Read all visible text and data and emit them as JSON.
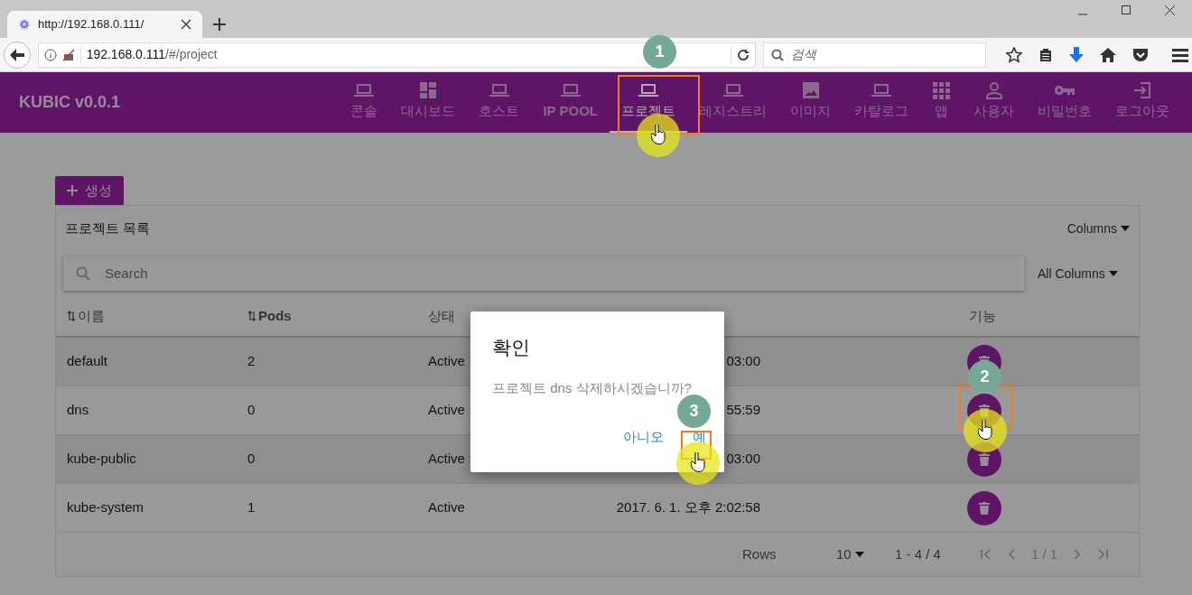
{
  "browser": {
    "tab_title": "http://192.168.0.111/",
    "url_host": "192.168.0.111",
    "url_path": "/#/project",
    "search_placeholder": "검색"
  },
  "app": {
    "title": "KUBIC v0.0.1"
  },
  "nav": [
    {
      "label": "콘솔",
      "kind": "laptop",
      "selected": false
    },
    {
      "label": "대시보드",
      "kind": "dashboard",
      "selected": false
    },
    {
      "label": "호스트",
      "kind": "laptop",
      "selected": false
    },
    {
      "label": "IP POOL",
      "kind": "laptop",
      "selected": false
    },
    {
      "label": "프로젝트",
      "kind": "laptop",
      "selected": true
    },
    {
      "label": "레지스트리",
      "kind": "laptop",
      "selected": false
    },
    {
      "label": "이미지",
      "kind": "image",
      "selected": false
    },
    {
      "label": "카탈로그",
      "kind": "laptop",
      "selected": false
    },
    {
      "label": "앱",
      "kind": "apps",
      "selected": false
    },
    {
      "label": "사용자",
      "kind": "person",
      "selected": false
    },
    {
      "label": "비밀번호",
      "kind": "key",
      "selected": false
    },
    {
      "label": "로그아웃",
      "kind": "exit",
      "selected": false
    }
  ],
  "create_button": "생성",
  "table": {
    "title": "프로젝트 목록",
    "columns_menu": "Columns",
    "search_placeholder": "Search",
    "filter": "All Columns",
    "columns": [
      {
        "label": "이름",
        "sortable": true
      },
      {
        "label": "Pods",
        "sortable": true
      },
      {
        "label": "상태",
        "sortable": false
      },
      {
        "label": "기능",
        "sortable": false
      }
    ],
    "rows": [
      {
        "name": "default",
        "pods": "2",
        "status": "Active",
        "created": "03:00"
      },
      {
        "name": "dns",
        "pods": "0",
        "status": "Active",
        "created": "55:59"
      },
      {
        "name": "kube-public",
        "pods": "0",
        "status": "Active",
        "created": "03:00"
      },
      {
        "name": "kube-system",
        "pods": "1",
        "status": "Active",
        "created": "2017. 6. 1. 오후 2:02:58"
      }
    ],
    "footer": {
      "rows_label": "Rows",
      "rows_value": "10",
      "range": "1 - 4 / 4",
      "page": "1 / 1"
    }
  },
  "dialog": {
    "title": "확인",
    "message": "프로젝트 dns 삭제하시겠습니까?",
    "buttons": [
      "아니오",
      "예"
    ]
  },
  "step_markers": [
    {
      "label": "1"
    },
    {
      "label": "2"
    },
    {
      "label": "3"
    }
  ]
}
